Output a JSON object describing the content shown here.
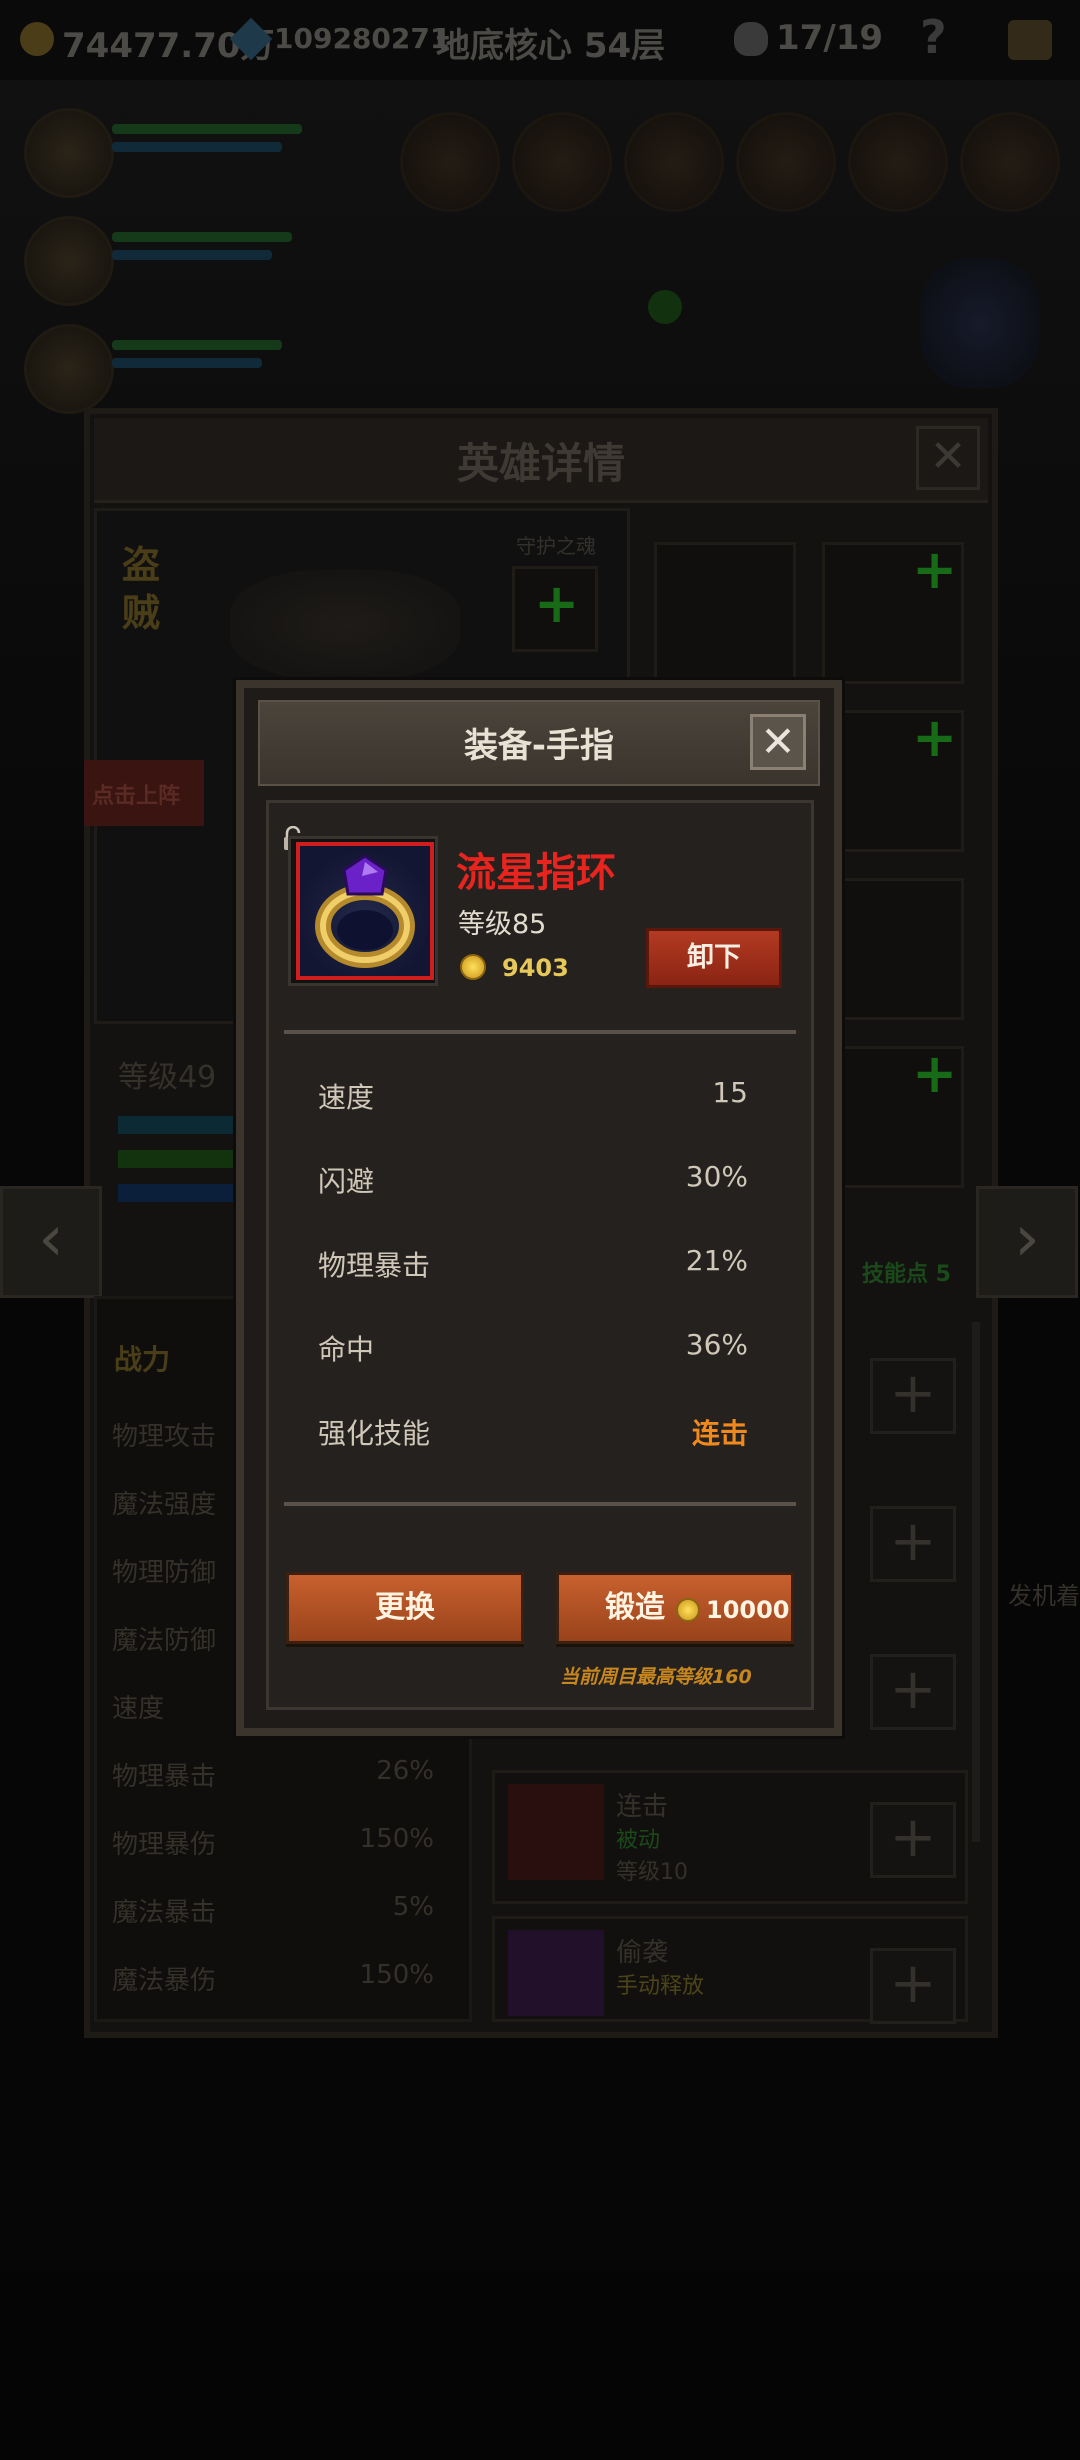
{
  "top_bar": {
    "gold": "74477.70万",
    "gems": "109280271",
    "location": "地底核心 54层",
    "deaths": "17/19",
    "help": "?"
  },
  "hero_panel": {
    "title": "英雄详情",
    "close": "✕",
    "hero_name_line1": "盗",
    "hero_name_line2": "贼",
    "guardian_label": "守护之魂",
    "deploy_label": "点击上阵",
    "level": "等级49",
    "skill_points": "技能点 5",
    "combat_power": "战力",
    "stats": [
      {
        "name": "物理攻击",
        "value": ""
      },
      {
        "name": "魔法强度",
        "value": ""
      },
      {
        "name": "物理防御",
        "value": ""
      },
      {
        "name": "魔法防御",
        "value": ""
      },
      {
        "name": "速度",
        "value": ""
      },
      {
        "name": "物理暴击",
        "value": "26%"
      },
      {
        "name": "物理暴伤",
        "value": "150%"
      },
      {
        "name": "魔法暴击",
        "value": "5%"
      },
      {
        "name": "魔法暴伤",
        "value": "150%"
      }
    ],
    "skills": [
      {
        "name": "连击",
        "type": "被动",
        "level": "等级10"
      },
      {
        "name": "偷袭",
        "type": "手动释放",
        "level": ""
      }
    ],
    "side_text": "发机着"
  },
  "modal": {
    "title": "装备-手指",
    "close": "✕",
    "item": {
      "name": "流星指环",
      "level": "等级85",
      "value": "9403",
      "unequip": "卸下"
    },
    "stats": [
      {
        "name": "速度",
        "value": "15"
      },
      {
        "name": "闪避",
        "value": "30%"
      },
      {
        "name": "物理暴击",
        "value": "21%"
      },
      {
        "name": "命中",
        "value": "36%"
      },
      {
        "name": "强化技能",
        "value": "连击"
      }
    ],
    "replace_button": "更换",
    "forge_button": "锻造",
    "forge_cost": "10000",
    "max_level_note": "当前周目最高等级160"
  },
  "colors": {
    "item_name": "#e8241e",
    "orange_button": "#c8602e",
    "enhanced_skill": "#f08a1e",
    "note": "#c7861e"
  }
}
